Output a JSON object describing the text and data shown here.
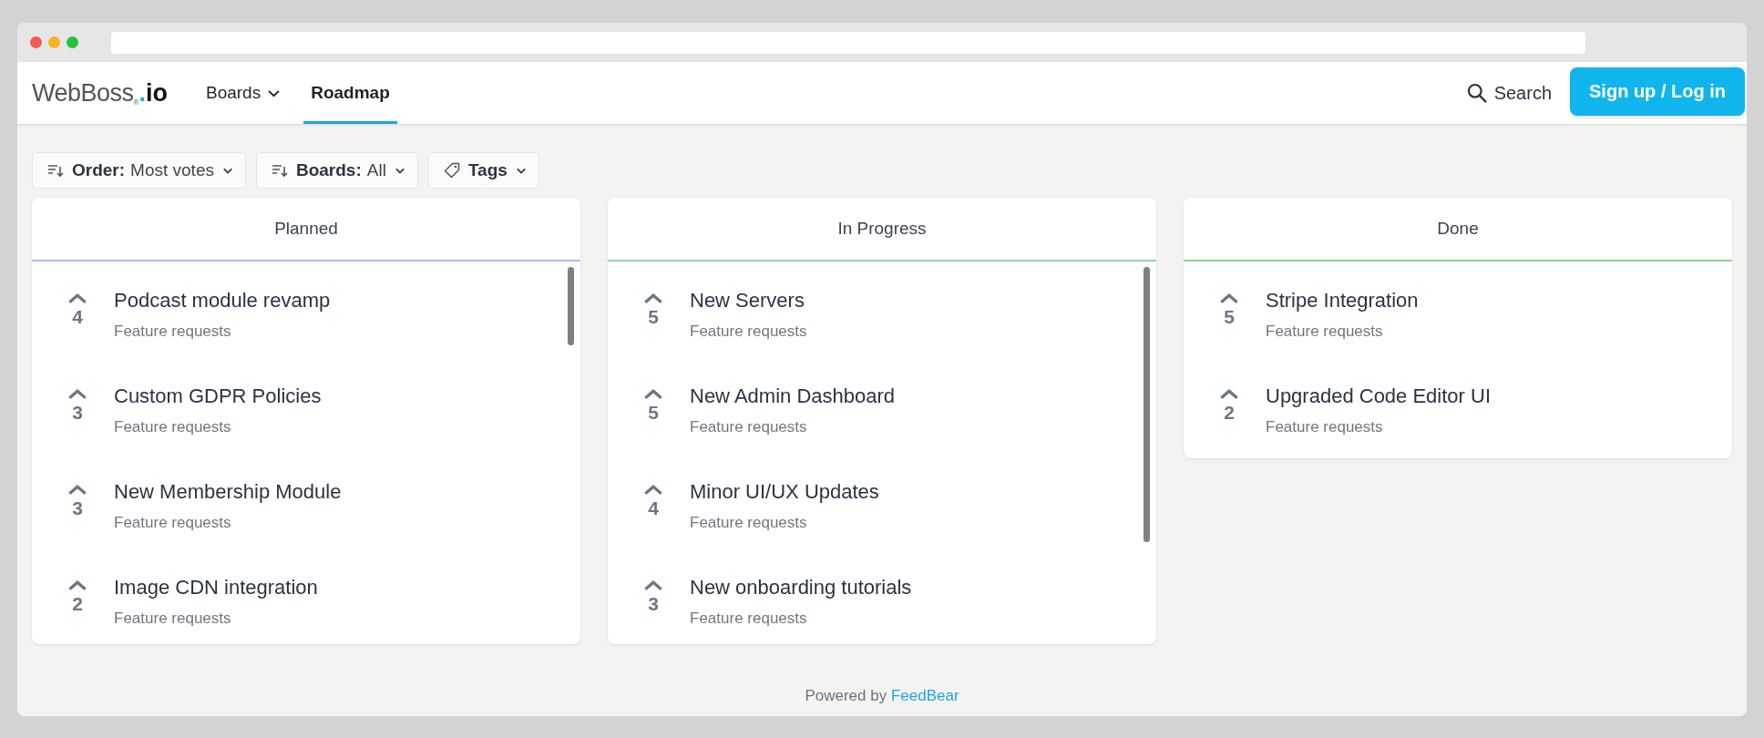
{
  "logo": {
    "name": "WebBoss",
    "mark": "®",
    "tld": ".io"
  },
  "nav": [
    {
      "label": "Boards",
      "dropdown": true,
      "selected": false
    },
    {
      "label": "Roadmap",
      "dropdown": false,
      "selected": true
    }
  ],
  "search": {
    "label": "Search"
  },
  "auth_button": {
    "label": "Sign up / Log in"
  },
  "filters": [
    {
      "kind": "sort",
      "label": "Order:",
      "value": "Most votes"
    },
    {
      "kind": "sort",
      "label": "Boards:",
      "value": "All"
    },
    {
      "kind": "tag",
      "label": "Tags"
    }
  ],
  "columns": [
    {
      "title": "Planned",
      "color": "#a9b8ee",
      "scrollbar": true,
      "items": [
        {
          "votes": "4",
          "title": "Podcast module revamp",
          "board": "Feature requests"
        },
        {
          "votes": "3",
          "title": "Custom GDPR Policies",
          "board": "Feature requests"
        },
        {
          "votes": "3",
          "title": "New Membership Module",
          "board": "Feature requests"
        },
        {
          "votes": "2",
          "title": "Image CDN integration",
          "board": "Feature requests"
        }
      ]
    },
    {
      "title": "In Progress",
      "color": "#8fd0b4",
      "scrollbar": true,
      "items": [
        {
          "votes": "5",
          "title": "New Servers",
          "board": "Feature requests"
        },
        {
          "votes": "5",
          "title": "New Admin Dashboard",
          "board": "Feature requests"
        },
        {
          "votes": "4",
          "title": "Minor UI/UX Updates",
          "board": "Feature requests"
        },
        {
          "votes": "3",
          "title": "New onboarding tutorials",
          "board": "Feature requests"
        }
      ]
    },
    {
      "title": "Done",
      "color": "#93d28f",
      "scrollbar": false,
      "items": [
        {
          "votes": "5",
          "title": "Stripe Integration",
          "board": "Feature requests"
        },
        {
          "votes": "2",
          "title": "Upgraded Code Editor UI",
          "board": "Feature requests"
        }
      ]
    }
  ],
  "footer": {
    "text": "Powered by",
    "link": "FeedBear"
  }
}
